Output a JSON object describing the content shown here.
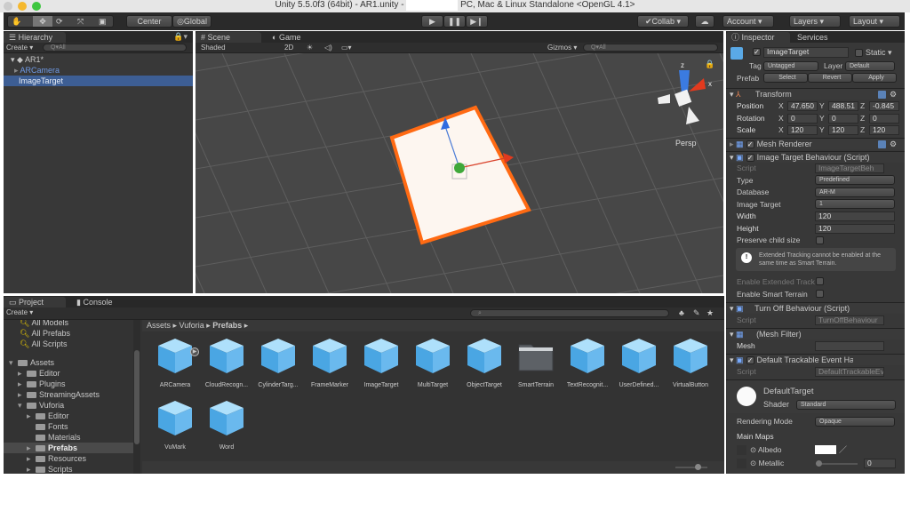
{
  "window": {
    "title": "Unity 5.5.0f3 (64bit) - AR1.unity - ",
    "title_right": "PC, Mac & Linux Standalone <OpenGL 4.1>"
  },
  "toolbar": {
    "center": "Center",
    "global": "Global",
    "collab": "Collab",
    "account": "Account",
    "layers": "Layers",
    "layout": "Layout"
  },
  "hierarchy": {
    "tab": "Hierarchy",
    "create": "Create",
    "search_placeholder": "Q▾All",
    "scene": "AR1*",
    "items": [
      {
        "label": "ARCamera"
      },
      {
        "label": "ImageTarget",
        "selected": true
      }
    ]
  },
  "scene": {
    "tab_scene": "Scene",
    "tab_game": "Game",
    "shading": "Shaded",
    "mode_2d": "2D",
    "gizmos": "Gizmos",
    "search_placeholder": "Q▾All",
    "persp": "Persp",
    "axis_x": "x",
    "axis_z": "z"
  },
  "inspector": {
    "tab": "Inspector",
    "tab_services": "Services",
    "name": "ImageTarget",
    "static": "Static",
    "tag_label": "Tag",
    "tag": "Untagged",
    "layer_label": "Layer",
    "layer": "Default",
    "prefab_label": "Prefab",
    "select": "Select",
    "revert": "Revert",
    "apply": "Apply",
    "transform": {
      "title": "Transform",
      "position": "Position",
      "rotation": "Rotation",
      "scale": "Scale",
      "pos": [
        "47.650",
        "488.51",
        "-0.845"
      ],
      "rot": [
        "0",
        "0",
        "0"
      ],
      "scl": [
        "120",
        "120",
        "120"
      ]
    },
    "mesh_renderer": "Mesh Renderer",
    "itb": {
      "title": "Image Target Behaviour (Script)",
      "script_label": "Script",
      "script": "ImageTargetBeh",
      "type_label": "Type",
      "type": "Predefined",
      "database_label": "Database",
      "database": "AR-M",
      "image_target_label": "Image Target",
      "image_target": "1",
      "width_label": "Width",
      "width": "120",
      "height_label": "Height",
      "height": "120",
      "preserve": "Preserve child size",
      "help": "Extended Tracking cannot be enabled at the same time as Smart Terrain.",
      "ext_tracking": "Enable Extended Tracking",
      "smart_terrain": "Enable Smart Terrain"
    },
    "turn_off": {
      "title": "Turn Off Behaviour (Script)",
      "script_label": "Script",
      "script": "TurnOffBehaviour"
    },
    "mesh_filter": {
      "title": "(Mesh Filter)",
      "mesh_label": "Mesh"
    },
    "dteh": {
      "title": "Default Trackable Event Handler",
      "script_label": "Script",
      "script": "DefaultTrackableEventHandler"
    },
    "material": {
      "name": "DefaultTarget",
      "shader_label": "Shader",
      "shader": "Standard",
      "rendering_mode_label": "Rendering Mode",
      "rendering_mode": "Opaque",
      "main_maps": "Main Maps",
      "albedo": "Albedo",
      "metallic": "Metallic",
      "metallic_value": "0"
    }
  },
  "project": {
    "tab": "Project",
    "tab_console": "Console",
    "create": "Create",
    "favorites": [
      {
        "label": "All Models"
      },
      {
        "label": "All Prefabs"
      },
      {
        "label": "All Scripts"
      }
    ],
    "tree": [
      {
        "label": "Assets",
        "depth": 0,
        "open": true
      },
      {
        "label": "Editor",
        "depth": 1
      },
      {
        "label": "Plugins",
        "depth": 1
      },
      {
        "label": "StreamingAssets",
        "depth": 1
      },
      {
        "label": "Vuforia",
        "depth": 1,
        "open": true
      },
      {
        "label": "Editor",
        "depth": 2
      },
      {
        "label": "Fonts",
        "depth": 2,
        "leaf": true
      },
      {
        "label": "Materials",
        "depth": 2,
        "leaf": true
      },
      {
        "label": "Prefabs",
        "depth": 2,
        "selected": true
      },
      {
        "label": "Resources",
        "depth": 2
      },
      {
        "label": "Scripts",
        "depth": 2
      }
    ],
    "breadcrumb": [
      "Assets",
      "Vuforia",
      "Prefabs"
    ],
    "assets": [
      {
        "label": "ARCamera",
        "icon": "prefab-cube"
      },
      {
        "label": "CloudRecogn...",
        "icon": "prefab-cube"
      },
      {
        "label": "CylinderTarg...",
        "icon": "prefab-cube"
      },
      {
        "label": "FrameMarker",
        "icon": "prefab-cube"
      },
      {
        "label": "ImageTarget",
        "icon": "prefab-cube"
      },
      {
        "label": "MultiTarget",
        "icon": "prefab-cube"
      },
      {
        "label": "ObjectTarget",
        "icon": "prefab-cube"
      },
      {
        "label": "SmartTerrain",
        "icon": "folder"
      },
      {
        "label": "TextRecognit...",
        "icon": "prefab-cube"
      },
      {
        "label": "UserDefined...",
        "icon": "prefab-cube"
      },
      {
        "label": "VirtualButton",
        "icon": "prefab-cube"
      },
      {
        "label": "VuMark",
        "icon": "prefab-cube"
      },
      {
        "label": "Word",
        "icon": "prefab-cube"
      }
    ]
  },
  "colors": {
    "selection": "#3d5e94",
    "accent_blue": "#5aa9e6",
    "target_outline": "#ff6a13"
  }
}
